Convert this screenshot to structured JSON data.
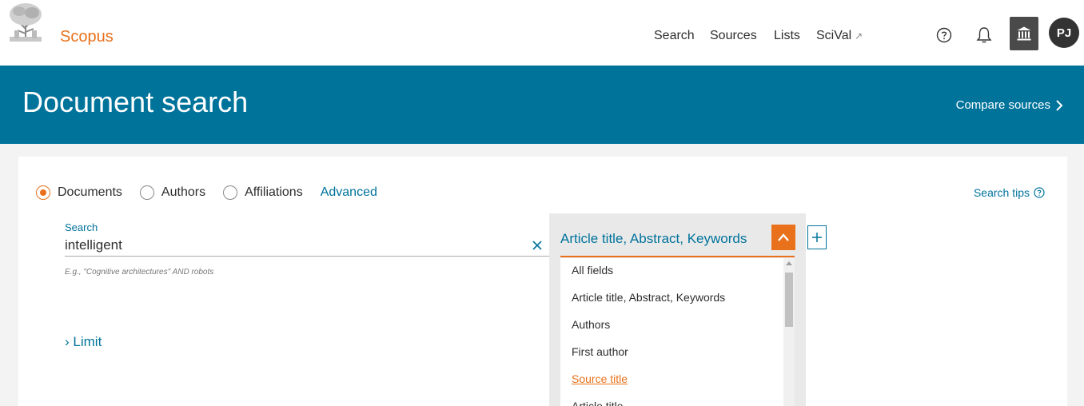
{
  "header": {
    "brand": "Scopus",
    "nav": {
      "search": "Search",
      "sources": "Sources",
      "lists": "Lists",
      "scival": "SciVal",
      "scival_icon": "external-link-icon"
    },
    "avatar_initials": "PJ",
    "icons": [
      "elsevier-tree-logo",
      "help-icon",
      "bell-icon",
      "institution-icon"
    ]
  },
  "banner": {
    "title": "Document search",
    "compare_label": "Compare sources"
  },
  "search_form": {
    "search_types": [
      {
        "label": "Documents",
        "selected": true
      },
      {
        "label": "Authors",
        "selected": false
      },
      {
        "label": "Affiliations",
        "selected": false
      }
    ],
    "advanced_label": "Advanced",
    "tips_label": "Search tips",
    "field_label": "Search",
    "field_value": "intelligent",
    "hint": "E.g., \"Cognitive architectures\" AND robots",
    "limit_label": "Limit",
    "field_select": {
      "selected": "Article title, Abstract, Keywords",
      "options": [
        "All fields",
        "Article title, Abstract, Keywords",
        "Authors",
        "First author",
        "Source title",
        "Article title"
      ],
      "highlighted": "Source title"
    }
  },
  "colors": {
    "accent": "#e9711c",
    "primary": "#00739b",
    "banner": "#00739b"
  }
}
